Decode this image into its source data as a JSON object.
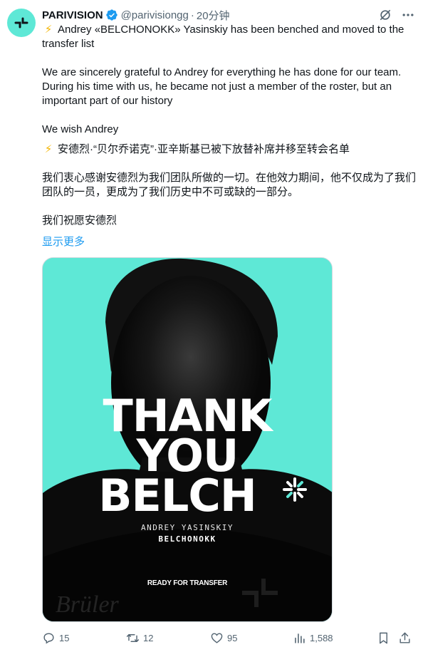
{
  "account": {
    "name": "PARIVISION",
    "handle": "@parivisiongg",
    "separator": "·",
    "time": "20分钟",
    "brand_color": "#5ee8d6",
    "verified_color": "#1d9bf0"
  },
  "tweet": {
    "bolt": "⚡",
    "line1": "Andrey «BELCHONOKK» Yasinskiy has been benched and moved to the transfer list",
    "line2": "We are sincerely grateful to Andrey for everything he has done for our team. During his time with us, he became not just a member of the roster, but an important part of our history",
    "line3": "We wish Andrey",
    "zh1": "安德烈·“贝尔乔诺克”·亚辛斯基已被下放替补席并移至转会名单",
    "zh2": "我们衷心感谢安德烈为我们团队所做的一切。在他效力期间，他不仅成为了我们团队的一员，更成为了我们历史中不可或缺的一部分。",
    "zh3": "我们祝愿安德烈",
    "show_more": "显示更多",
    "link_color": "#1d9bf0"
  },
  "media": {
    "title_line1": "THANK",
    "title_line2": "YOU",
    "title_line3": "BELCH",
    "player_name": "ANDREY YASINSKIY",
    "player_nick": "BELCHONOKK",
    "status": "READY FOR TRANSFER",
    "sponsor": "Brüler",
    "background_color": "#5ee8d6"
  },
  "actions": {
    "replies": "15",
    "retweets": "12",
    "likes": "95",
    "views": "1,588",
    "icon_color": "#536471"
  },
  "icons": {
    "reply": "reply-icon",
    "retweet": "retweet-icon",
    "like": "heart-icon",
    "views": "views-chart-icon",
    "bookmark": "bookmark-icon",
    "share": "share-icon",
    "grok": "grok-icon",
    "more": "more-icon"
  }
}
